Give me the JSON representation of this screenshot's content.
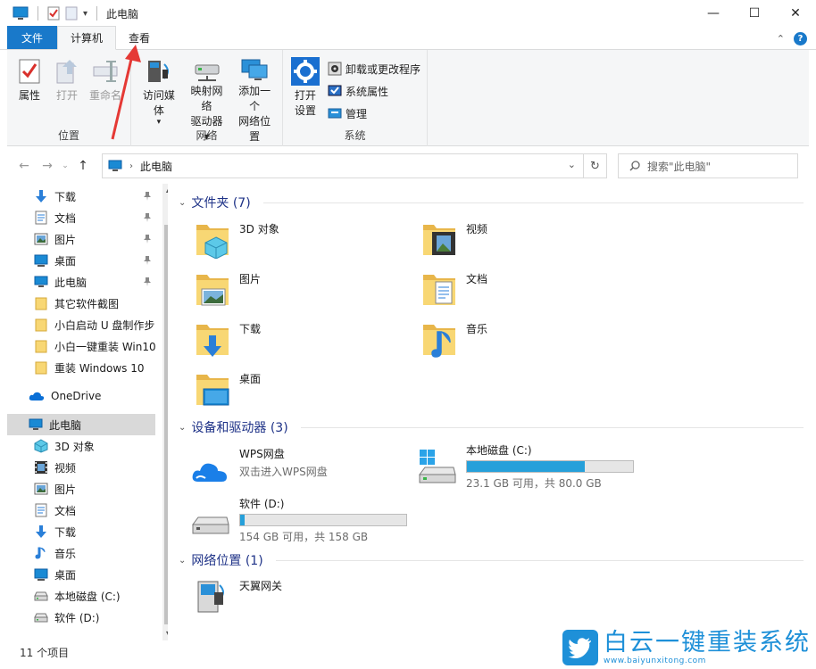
{
  "window": {
    "title": "此电脑",
    "minimize": "—",
    "maximize": "☐",
    "close": "✕"
  },
  "tabs": {
    "file": "文件",
    "computer": "计算机",
    "view": "查看"
  },
  "ribbon": {
    "location": {
      "label": "位置",
      "properties": "属性",
      "open": "打开",
      "rename": "重命名"
    },
    "network": {
      "label": "网络",
      "media_line1": "访问媒体",
      "map_line1": "映射网络",
      "map_line2": "驱动器 ▾",
      "add_line1": "添加一个",
      "add_line2": "网络位置"
    },
    "system": {
      "label": "系统",
      "open_settings_line1": "打开",
      "open_settings_line2": "设置",
      "uninstall": "卸载或更改程序",
      "sys_props": "系统属性",
      "manage": "管理"
    }
  },
  "address": {
    "crumb": "此电脑",
    "search_placeholder": "搜索\"此电脑\""
  },
  "nav": {
    "quick": [
      {
        "label": "下载",
        "icon": "download-icon"
      },
      {
        "label": "文档",
        "icon": "document-icon"
      },
      {
        "label": "图片",
        "icon": "pictures-icon"
      },
      {
        "label": "桌面",
        "icon": "desktop-icon"
      },
      {
        "label": "此电脑",
        "icon": "computer-icon"
      },
      {
        "label": "其它软件截图",
        "icon": "folder-icon"
      },
      {
        "label": "小白启动 U 盘制作步",
        "icon": "folder-icon"
      },
      {
        "label": "小白一键重装 Win10",
        "icon": "folder-icon"
      },
      {
        "label": "重装 Windows 10",
        "icon": "folder-icon"
      }
    ],
    "onedrive": "OneDrive",
    "thispc": "此电脑",
    "pc_items": [
      {
        "label": "3D 对象",
        "icon": "3d-objects-icon"
      },
      {
        "label": "视频",
        "icon": "video-icon"
      },
      {
        "label": "图片",
        "icon": "pictures-icon"
      },
      {
        "label": "文档",
        "icon": "document-icon"
      },
      {
        "label": "下载",
        "icon": "download-icon"
      },
      {
        "label": "音乐",
        "icon": "music-icon"
      },
      {
        "label": "桌面",
        "icon": "desktop-icon"
      },
      {
        "label": "本地磁盘 (C:)",
        "icon": "drive-icon"
      },
      {
        "label": "软件 (D:)",
        "icon": "drive-icon"
      }
    ]
  },
  "content": {
    "folders_header": "文件夹 (7)",
    "folders": [
      {
        "label": "3D 对象",
        "icon": "3d-objects-folder-icon"
      },
      {
        "label": "视频",
        "icon": "video-folder-icon"
      },
      {
        "label": "图片",
        "icon": "pictures-folder-icon"
      },
      {
        "label": "文档",
        "icon": "documents-folder-icon"
      },
      {
        "label": "下载",
        "icon": "downloads-folder-icon"
      },
      {
        "label": "音乐",
        "icon": "music-folder-icon"
      },
      {
        "label": "桌面",
        "icon": "desktop-folder-icon"
      }
    ],
    "devices_header": "设备和驱动器 (3)",
    "wps": {
      "name": "WPS网盘",
      "sub": "双击进入WPS网盘"
    },
    "drive_c": {
      "name": "本地磁盘 (C:)",
      "free": "23.1 GB 可用，共 80.0 GB",
      "used_fraction": 0.71
    },
    "drive_d": {
      "name": "软件 (D:)",
      "free": "154 GB 可用，共 158 GB",
      "used_fraction": 0.025
    },
    "network_header": "网络位置 (1)",
    "network_item": "天翼网关"
  },
  "status": {
    "count": "11 个项目"
  },
  "watermark": {
    "brand": "白云一键重装系统",
    "url": "www.baiyunxitong.com"
  },
  "colors": {
    "accent": "#1979ca",
    "section_header": "#1e3287",
    "drive_fill": "#26a0da",
    "watermark": "#1e90d8",
    "arrow": "#e53935"
  }
}
